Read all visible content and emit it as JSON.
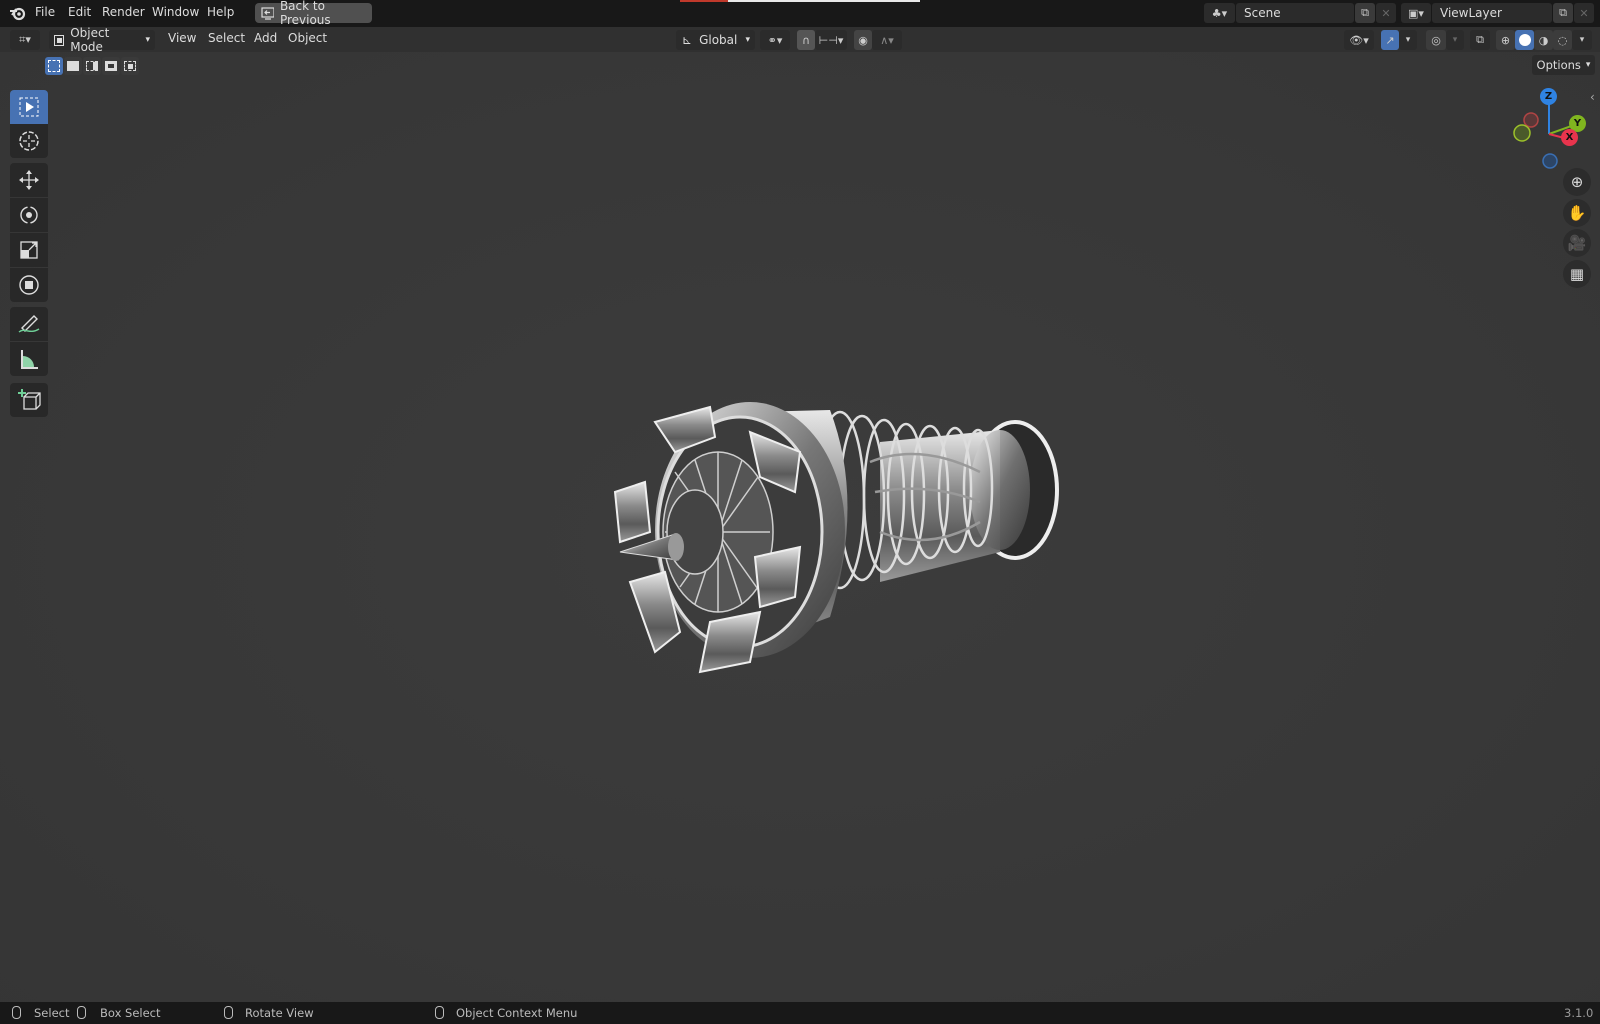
{
  "topbar": {
    "menus": [
      "File",
      "Edit",
      "Render",
      "Window",
      "Help"
    ],
    "back_button": "Back to Previous",
    "scene": "Scene",
    "view_layer": "ViewLayer"
  },
  "header": {
    "mode": "Object Mode",
    "menus": [
      "View",
      "Select",
      "Add",
      "Object"
    ],
    "transform_orientation": "Global",
    "options": "Options"
  },
  "toolbar": {
    "tools": [
      "select-box",
      "cursor",
      "move",
      "rotate",
      "scale",
      "transform",
      "annotate",
      "measure",
      "add-cube"
    ],
    "active": "select-box"
  },
  "gizmo": {
    "x": "X",
    "y": "Y",
    "z": "Z"
  },
  "statusbar": {
    "items": [
      "Select",
      "Box Select",
      "Rotate View",
      "Object Context Menu"
    ],
    "version": "3.1.0"
  },
  "colors": {
    "accent": "#4772b3",
    "x_axis": "#e8344d",
    "y_axis": "#80b51f",
    "z_axis": "#2f83e3"
  }
}
